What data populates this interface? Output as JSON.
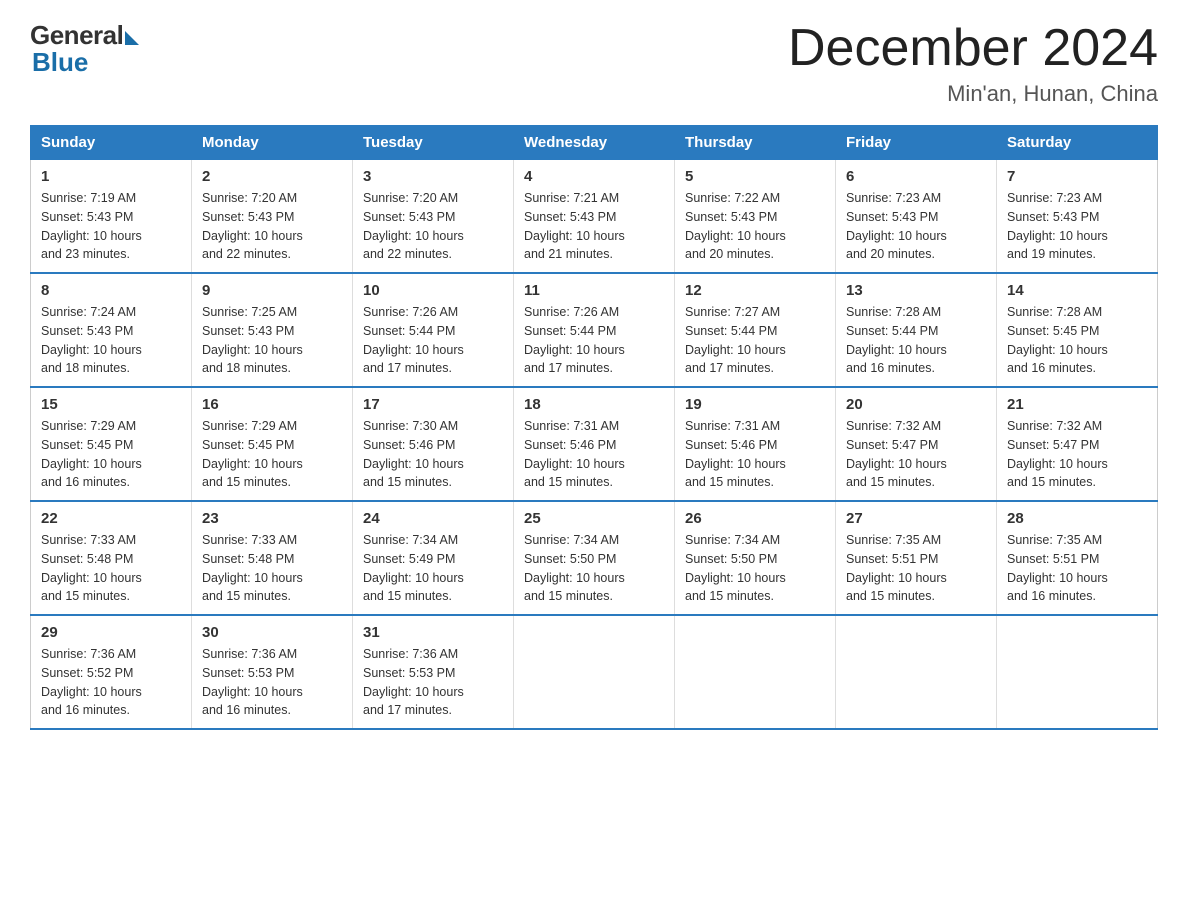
{
  "logo": {
    "general": "General",
    "blue": "Blue"
  },
  "header": {
    "title": "December 2024",
    "subtitle": "Min'an, Hunan, China"
  },
  "weekdays": [
    "Sunday",
    "Monday",
    "Tuesday",
    "Wednesday",
    "Thursday",
    "Friday",
    "Saturday"
  ],
  "weeks": [
    [
      {
        "day": "1",
        "sunrise": "7:19 AM",
        "sunset": "5:43 PM",
        "daylight": "10 hours and 23 minutes."
      },
      {
        "day": "2",
        "sunrise": "7:20 AM",
        "sunset": "5:43 PM",
        "daylight": "10 hours and 22 minutes."
      },
      {
        "day": "3",
        "sunrise": "7:20 AM",
        "sunset": "5:43 PM",
        "daylight": "10 hours and 22 minutes."
      },
      {
        "day": "4",
        "sunrise": "7:21 AM",
        "sunset": "5:43 PM",
        "daylight": "10 hours and 21 minutes."
      },
      {
        "day": "5",
        "sunrise": "7:22 AM",
        "sunset": "5:43 PM",
        "daylight": "10 hours and 20 minutes."
      },
      {
        "day": "6",
        "sunrise": "7:23 AM",
        "sunset": "5:43 PM",
        "daylight": "10 hours and 20 minutes."
      },
      {
        "day": "7",
        "sunrise": "7:23 AM",
        "sunset": "5:43 PM",
        "daylight": "10 hours and 19 minutes."
      }
    ],
    [
      {
        "day": "8",
        "sunrise": "7:24 AM",
        "sunset": "5:43 PM",
        "daylight": "10 hours and 18 minutes."
      },
      {
        "day": "9",
        "sunrise": "7:25 AM",
        "sunset": "5:43 PM",
        "daylight": "10 hours and 18 minutes."
      },
      {
        "day": "10",
        "sunrise": "7:26 AM",
        "sunset": "5:44 PM",
        "daylight": "10 hours and 17 minutes."
      },
      {
        "day": "11",
        "sunrise": "7:26 AM",
        "sunset": "5:44 PM",
        "daylight": "10 hours and 17 minutes."
      },
      {
        "day": "12",
        "sunrise": "7:27 AM",
        "sunset": "5:44 PM",
        "daylight": "10 hours and 17 minutes."
      },
      {
        "day": "13",
        "sunrise": "7:28 AM",
        "sunset": "5:44 PM",
        "daylight": "10 hours and 16 minutes."
      },
      {
        "day": "14",
        "sunrise": "7:28 AM",
        "sunset": "5:45 PM",
        "daylight": "10 hours and 16 minutes."
      }
    ],
    [
      {
        "day": "15",
        "sunrise": "7:29 AM",
        "sunset": "5:45 PM",
        "daylight": "10 hours and 16 minutes."
      },
      {
        "day": "16",
        "sunrise": "7:29 AM",
        "sunset": "5:45 PM",
        "daylight": "10 hours and 15 minutes."
      },
      {
        "day": "17",
        "sunrise": "7:30 AM",
        "sunset": "5:46 PM",
        "daylight": "10 hours and 15 minutes."
      },
      {
        "day": "18",
        "sunrise": "7:31 AM",
        "sunset": "5:46 PM",
        "daylight": "10 hours and 15 minutes."
      },
      {
        "day": "19",
        "sunrise": "7:31 AM",
        "sunset": "5:46 PM",
        "daylight": "10 hours and 15 minutes."
      },
      {
        "day": "20",
        "sunrise": "7:32 AM",
        "sunset": "5:47 PM",
        "daylight": "10 hours and 15 minutes."
      },
      {
        "day": "21",
        "sunrise": "7:32 AM",
        "sunset": "5:47 PM",
        "daylight": "10 hours and 15 minutes."
      }
    ],
    [
      {
        "day": "22",
        "sunrise": "7:33 AM",
        "sunset": "5:48 PM",
        "daylight": "10 hours and 15 minutes."
      },
      {
        "day": "23",
        "sunrise": "7:33 AM",
        "sunset": "5:48 PM",
        "daylight": "10 hours and 15 minutes."
      },
      {
        "day": "24",
        "sunrise": "7:34 AM",
        "sunset": "5:49 PM",
        "daylight": "10 hours and 15 minutes."
      },
      {
        "day": "25",
        "sunrise": "7:34 AM",
        "sunset": "5:50 PM",
        "daylight": "10 hours and 15 minutes."
      },
      {
        "day": "26",
        "sunrise": "7:34 AM",
        "sunset": "5:50 PM",
        "daylight": "10 hours and 15 minutes."
      },
      {
        "day": "27",
        "sunrise": "7:35 AM",
        "sunset": "5:51 PM",
        "daylight": "10 hours and 15 minutes."
      },
      {
        "day": "28",
        "sunrise": "7:35 AM",
        "sunset": "5:51 PM",
        "daylight": "10 hours and 16 minutes."
      }
    ],
    [
      {
        "day": "29",
        "sunrise": "7:36 AM",
        "sunset": "5:52 PM",
        "daylight": "10 hours and 16 minutes."
      },
      {
        "day": "30",
        "sunrise": "7:36 AM",
        "sunset": "5:53 PM",
        "daylight": "10 hours and 16 minutes."
      },
      {
        "day": "31",
        "sunrise": "7:36 AM",
        "sunset": "5:53 PM",
        "daylight": "10 hours and 17 minutes."
      },
      null,
      null,
      null,
      null
    ]
  ],
  "labels": {
    "sunrise": "Sunrise:",
    "sunset": "Sunset:",
    "daylight": "Daylight:"
  }
}
